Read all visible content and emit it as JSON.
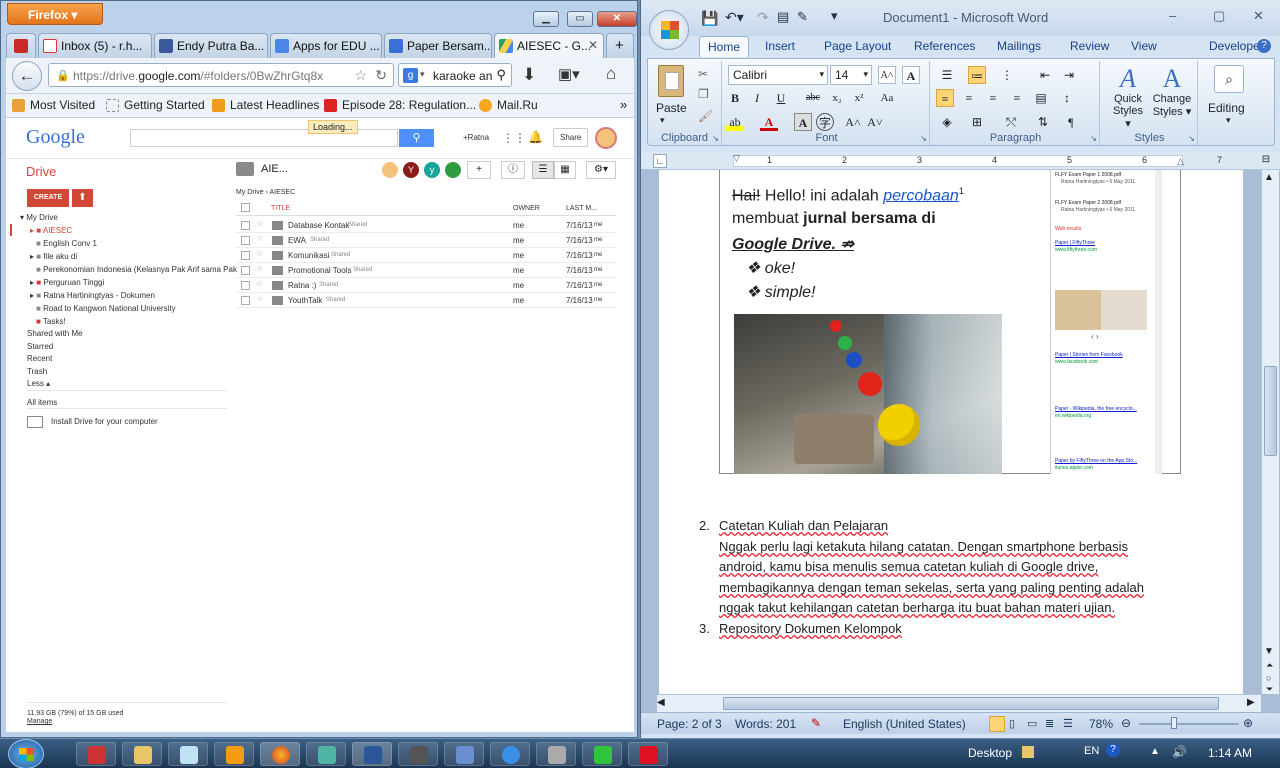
{
  "firefox": {
    "menu_button": "Firefox",
    "tabs": [
      {
        "label": "Inbox (5) - r.h..."
      },
      {
        "label": "Endy Putra Ba..."
      },
      {
        "label": "Apps for EDU ..."
      },
      {
        "label": "Paper Bersam..."
      },
      {
        "label": "AIESEC - G..."
      }
    ],
    "url_prefix": "https://drive.",
    "url_domain": "google.com",
    "url_rest": "/#folders/0BwZhrGtq8x",
    "search_value": "karaoke an",
    "bookmarks": [
      "Most Visited",
      "Getting Started",
      "Latest Headlines",
      "Episode 28: Regulation...",
      "Mail.Ru"
    ],
    "bookmarks_more": "»"
  },
  "drive": {
    "logo": "Google",
    "loading": "Loading...",
    "user": "+Ratna",
    "share": "Share",
    "drive_label": "Drive",
    "create": "CREATE",
    "folder_title": "AIE...",
    "breadcrumb_root": "My Drive",
    "breadcrumb_sep": "›",
    "breadcrumb_current": "AIESEC",
    "col_title": "TITLE",
    "col_owner": "OWNER",
    "col_modified": "LAST M...",
    "tree": [
      "My Drive",
      "AIESEC",
      "English Conv 1",
      "file aku di",
      "Perekonomian Indonesia (Kelasnya Pak Arif sama Pak",
      "Perguruan Tinggi",
      "Ratna Hartiningtyas - Dokumen",
      "Road to Kangwon National University",
      "Tasks!"
    ],
    "nav": [
      "Shared with Me",
      "Starred",
      "Recent",
      "Trash",
      "Less ▴"
    ],
    "all_items": "All items",
    "install": "Install Drive for your computer",
    "storage": "11.93 GB (79%) of 15 GB used",
    "manage": "Manage",
    "files": [
      {
        "name": "Database Kontak",
        "tag": "Shared",
        "owner": "me",
        "date": "7/16/13",
        "by": "me"
      },
      {
        "name": "EWA",
        "tag": "Shared",
        "owner": "me",
        "date": "7/16/13",
        "by": "me"
      },
      {
        "name": "Komunikasi",
        "tag": "Shared",
        "owner": "me",
        "date": "7/16/13",
        "by": "me"
      },
      {
        "name": "Promotional Tools",
        "tag": "Shared",
        "owner": "me",
        "date": "7/16/13",
        "by": "me"
      },
      {
        "name": "Ratna :)",
        "tag": "Shared",
        "owner": "me",
        "date": "7/16/13",
        "by": "me"
      },
      {
        "name": "YouthTalk",
        "tag": "Shared",
        "owner": "me",
        "date": "7/16/13",
        "by": "me"
      }
    ],
    "avatars": [
      "Y",
      "y"
    ]
  },
  "word": {
    "title": "Document1 - Microsoft Word",
    "tabs": [
      "Home",
      "Insert",
      "Page Layout",
      "References",
      "Mailings",
      "Review",
      "View",
      "Developer"
    ],
    "clipboard": {
      "paste": "Paste",
      "label": "Clipboard"
    },
    "font": {
      "name": "Calibri",
      "size": "14",
      "label": "Font"
    },
    "paragraph_label": "Paragraph",
    "styles": {
      "quick": "Quick",
      "quick2": "Styles ▾",
      "change": "Change",
      "change2": "Styles ▾",
      "label": "Styles"
    },
    "editing": "Editing",
    "ruler_marks": [
      "1",
      "2",
      "3",
      "4",
      "5",
      "6",
      "7"
    ],
    "doc": {
      "hai": "Hai!",
      "line1a": " Hello! ini adalah ",
      "link": "percobaan",
      "sup": "1",
      "line2a": "membuat ",
      "line2b": "jurnal bersama di",
      "line3": "Google Drive.",
      "bullets": [
        "oke!",
        "simple!"
      ],
      "item2_num": "2.",
      "item2_title": "Catetan Kuliah dan Pelajaran",
      "item2_body": [
        "Nggak perlu lagi ketakuta hilang catatan. Dengan smartphone berbasis",
        "android, kamu bisa menulis semua catetan kuliah di Google drive,",
        "membagikannya dengan teman sekelas, serta yang paling penting adalah",
        "nggak takut kehilangan catetan berharga itu buat bahan materi ujian."
      ],
      "item3_num": "3.",
      "item3_title": "Repository Dokumen Kelompok"
    },
    "side_results": {
      "r1": "FLFY Exam Paper 1 2008.pdf",
      "r1_by": "Ratna Hartiningtyas • 6 May 2011",
      "r2": "FLFY Exam Paper 2 2008.pdf",
      "r2_by": "Ratna Hartiningtyas • 6 May 2011",
      "web": "Web results",
      "w1": "Paper | FiftyThree",
      "w1_url": "www.fiftythree.com",
      "w2": "Paper | Stories from Facebook",
      "w2_url": "www.facebook.com",
      "w3": "Paper - Wikipedia, the free encyclo...",
      "w3_url": "en.wikipedia.org",
      "w4": "Paper by FiftyThree on the App Sto...",
      "w4_url": "itunes.apple.com"
    },
    "status": {
      "page": "Page: 2 of 3",
      "words": "Words: 201",
      "lang": "English (United States)",
      "zoom": "78%"
    }
  },
  "taskbar": {
    "desktop": "Desktop",
    "lang": "EN",
    "time": "1:14 AM"
  }
}
